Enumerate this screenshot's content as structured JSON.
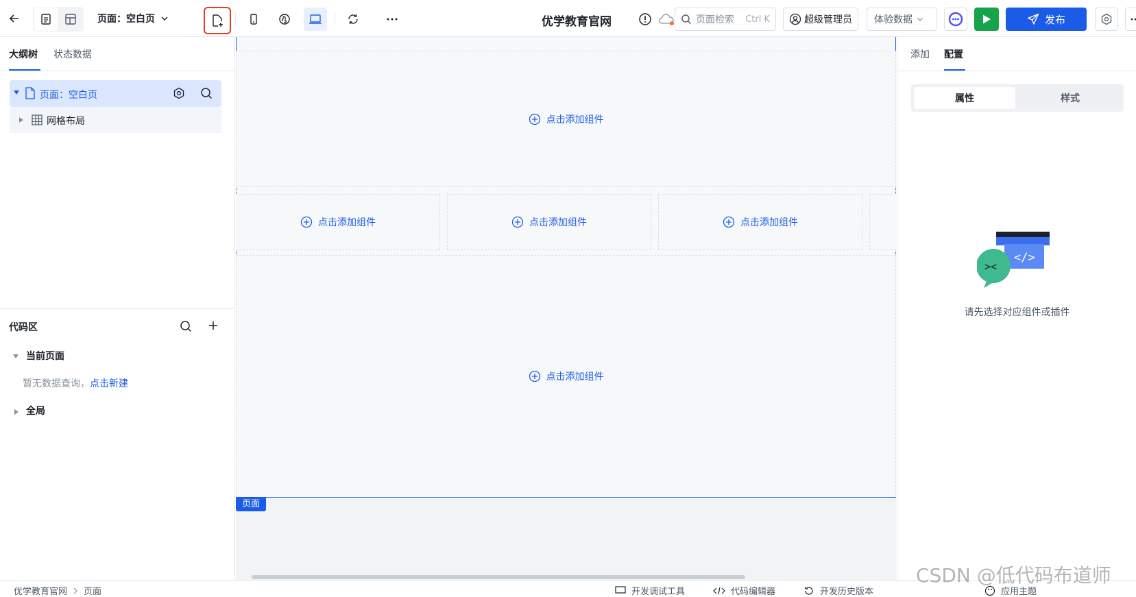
{
  "toolbar": {
    "back_icon": "arrow-left-icon",
    "page_selector_label": "页面：空白页",
    "app_title": "优学教育官网",
    "search_placeholder": "页面检索",
    "search_shortcut": "Ctrl K",
    "user_label": "超级管理员",
    "data_mode_label": "体验数据",
    "publish_label": "发布",
    "accent_color": "#1a5be8",
    "run_color": "#16a34a"
  },
  "left": {
    "tabs": [
      {
        "label": "大纲树"
      },
      {
        "label": "状态数据"
      }
    ],
    "tree": [
      {
        "label": "页面：空白页"
      },
      {
        "label": "网格布局"
      }
    ],
    "code_area": {
      "title": "代码区",
      "current_page": "当前页面",
      "empty_text": "暂无数据查询，",
      "create_link": "点击新建",
      "global": "全局"
    }
  },
  "canvas": {
    "add_component_label": "点击添加组件",
    "page_tag": "页面"
  },
  "right": {
    "tabs": [
      {
        "label": "添加"
      },
      {
        "label": "配置"
      }
    ],
    "segments": [
      {
        "label": "属性"
      },
      {
        "label": "样式"
      }
    ],
    "empty_hint": "请先选择对应组件或插件"
  },
  "statusbar": {
    "breadcrumb": [
      "优学教育官网",
      "页面"
    ],
    "dev_tools": "开发调试工具",
    "code_editor": "代码编辑器",
    "history": "开发历史版本",
    "theme": "应用主题"
  },
  "watermark": "CSDN @低代码布道师"
}
